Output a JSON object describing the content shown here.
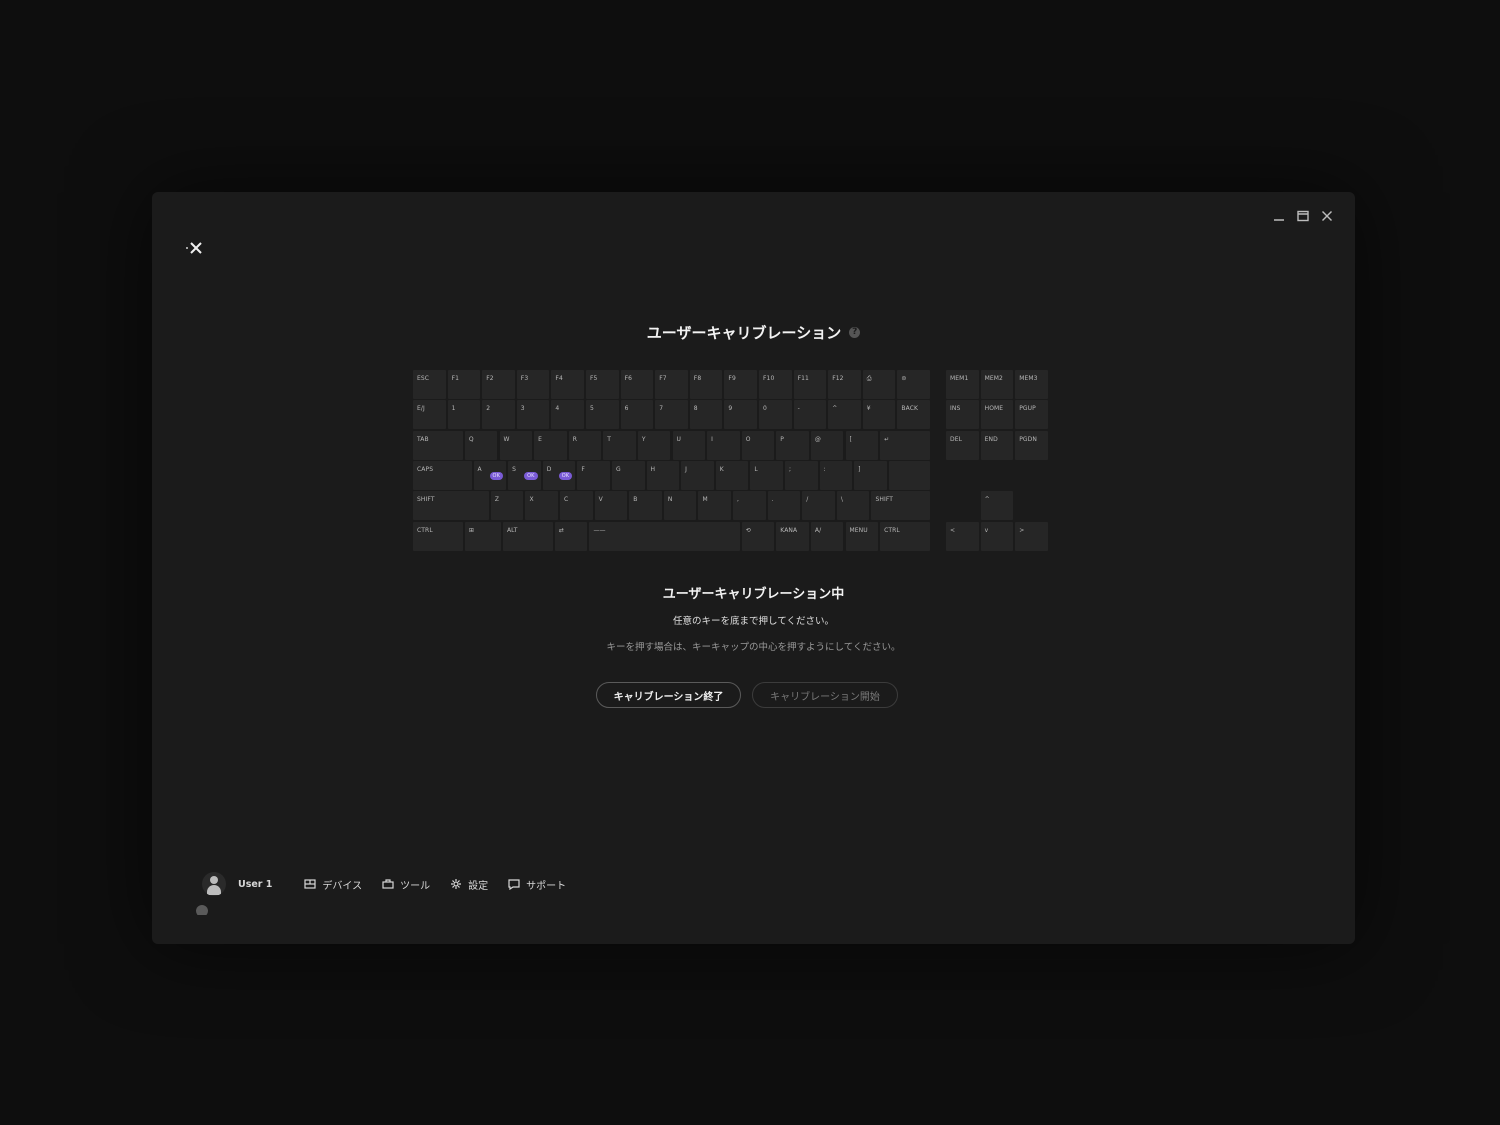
{
  "calibration": {
    "title": "ユーザーキャリブレーション",
    "status_title": "ユーザーキャリブレーション中",
    "instruction": "任意のキーを底まで押してください。",
    "hint": "キーを押す場合は、キーキャップの中心を押すようにしてください。",
    "end_button": "キャリブレーション終了",
    "start_button": "キャリブレーション開始",
    "ok_badge": "OK",
    "ok_color": "#7a5bd6"
  },
  "keyboard": {
    "rows": [
      [
        "ESC",
        "F1",
        "F2",
        "F3",
        "F4",
        "F5",
        "F6",
        "F7",
        "F8",
        "F9",
        "F10",
        "F11",
        "F12",
        "⎙",
        "⊜"
      ],
      [
        "E/J",
        "1",
        "2",
        "3",
        "4",
        "5",
        "6",
        "7",
        "8",
        "9",
        "0",
        "-",
        "^",
        "¥",
        "BACK"
      ],
      [
        "TAB",
        "Q",
        "W",
        "E",
        "R",
        "T",
        "Y",
        "U",
        "I",
        "O",
        "P",
        "@",
        "[",
        "↵"
      ],
      [
        "CAPS",
        "A",
        "S",
        "D",
        "F",
        "G",
        "H",
        "J",
        "K",
        "L",
        ";",
        ":",
        "]"
      ],
      [
        "SHIFT",
        "Z",
        "X",
        "C",
        "V",
        "B",
        "N",
        "M",
        ",",
        ".",
        "/",
        "\\",
        "SHIFT"
      ],
      [
        "CTRL",
        "⊞",
        "ALT",
        "⇄",
        "——",
        "⟲",
        "KANA",
        "A/",
        "MENU",
        "CTRL"
      ]
    ],
    "nav_cluster": [
      [
        "MEM1",
        "MEM2",
        "MEM3"
      ],
      [
        "INS",
        "HOME",
        "PGUP"
      ],
      [
        "DEL",
        "END",
        "PGDN"
      ]
    ],
    "arrows": [
      "^",
      "<",
      "v",
      ">"
    ],
    "ok_keys": [
      "A",
      "S",
      "D"
    ]
  },
  "footer": {
    "user": "User 1",
    "nav": [
      {
        "label": "デバイス",
        "icon": "device-icon"
      },
      {
        "label": "ツール",
        "icon": "tool-icon"
      },
      {
        "label": "設定",
        "icon": "gear-icon"
      },
      {
        "label": "サポート",
        "icon": "chat-icon"
      }
    ]
  }
}
